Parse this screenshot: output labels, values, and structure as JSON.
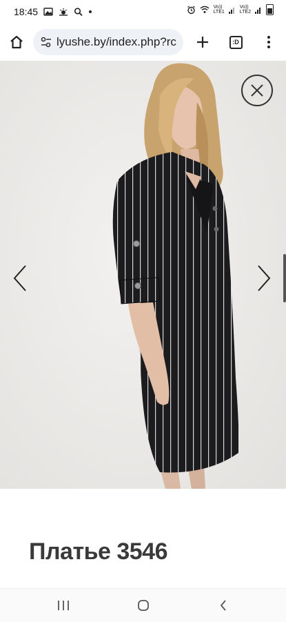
{
  "status_bar": {
    "time": "18:45",
    "sim1": "Vo))\nLTE1",
    "sim2": "Vo))\nLTE2"
  },
  "browser": {
    "url": "lyushe.by/index.php?rc",
    "tab_count": ":D"
  },
  "icons": {
    "home": "home-icon",
    "site_settings": "tune-icon",
    "new_tab": "plus-icon",
    "menu": "more-vert-icon",
    "close": "close-icon",
    "prev": "chevron-left-icon",
    "next": "chevron-right-icon",
    "recents": "recents-icon",
    "home_nav": "nav-home-icon",
    "back": "back-icon"
  },
  "product": {
    "title": "Платье 3546"
  },
  "colors": {
    "gallery_bg": "#eceae7",
    "dress": "#1c1c1e",
    "stripe": "#d8d8d8",
    "title": "#3a3a3a"
  }
}
